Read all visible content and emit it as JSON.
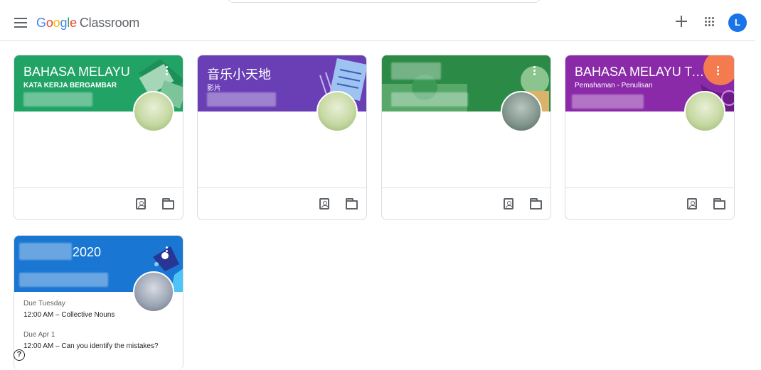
{
  "app": {
    "logo_google": [
      "G",
      "o",
      "o",
      "g",
      "l",
      "e"
    ],
    "product_name": "Classroom",
    "avatar_initial": "L"
  },
  "icons": {
    "menu": "hamburger-menu-icon",
    "create": "plus-icon",
    "apps": "apps-grid-icon",
    "more": "more-vert-icon",
    "assignments": "assignment-ind-icon",
    "folder": "folder-icon",
    "help": "help-icon"
  },
  "colors": {
    "card1": "#21a366",
    "card2": "#6a3fb5",
    "card3": "#1e7d3c",
    "card4": "#8a2aa8",
    "card5": "#1976d2"
  },
  "classes": [
    {
      "title": "BAHASA MELAYU",
      "section": "KATA KERJA BERGAMBAR"
    },
    {
      "title": "音乐小天地",
      "section": "影片"
    },
    {
      "title": "",
      "section": ""
    },
    {
      "title": "BAHASA MELAYU TA...",
      "section": "Pemahaman - Penulisan"
    },
    {
      "title": "2020",
      "section": "",
      "due": [
        {
          "label": "Due Tuesday",
          "item": "12:00 AM – Collective Nouns"
        },
        {
          "label": "Due Apr 1",
          "item": "12:00 AM – Can you identify the mistakes?"
        }
      ]
    }
  ],
  "help": {
    "glyph": "?"
  }
}
